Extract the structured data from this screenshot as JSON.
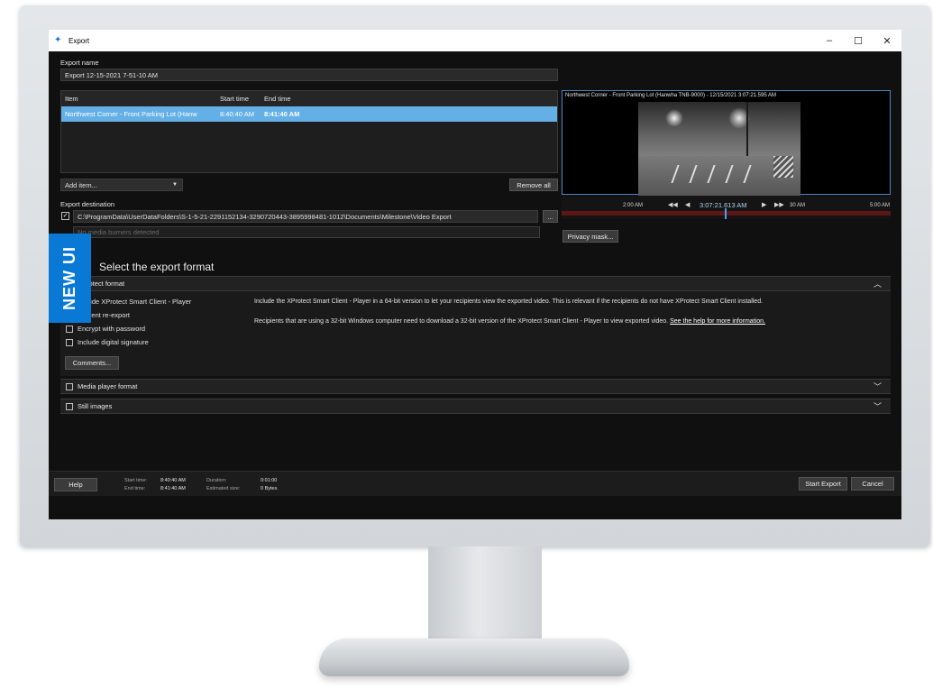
{
  "window": {
    "title": "Export",
    "controls": [
      "–",
      "☐",
      "✕"
    ]
  },
  "export_name": {
    "label": "Export name",
    "value": "Export 12-15-2021 7-51-10 AM"
  },
  "items_table": {
    "columns": [
      "Item",
      "Start time",
      "End time"
    ],
    "rows": [
      {
        "item": "Northwest Corner - Front Parking Lot  (Hanw",
        "start": "8:40:40 AM",
        "end": "8:41:40 AM"
      }
    ]
  },
  "add_item": {
    "label": "Add item..."
  },
  "remove_all": {
    "label": "Remove all"
  },
  "export_destination": {
    "label": "Export destination",
    "path": "C:\\ProgramData\\UserDataFolders\\S-1-5-21-2291152134-3290720443-3895998481-1012\\Documents\\Milestone\\Video Export",
    "browse_label": "...",
    "media_burners": "No media burners detected"
  },
  "preview": {
    "title": "Northwest Corner - Front Parking Lot  (Hanwha TNB-9000) - 12/15/2021 3:07:21.595 AM",
    "timeline_time": "3:07:21.613 AM",
    "tick_left": "2:00 AM",
    "tick_mid": "30 AM",
    "tick_right": "5:00 AM"
  },
  "privacy_mask": {
    "label": "Privacy mask..."
  },
  "section_title": "Select the export format",
  "xprotect": {
    "header": "XProtect format",
    "options": [
      "Include XProtect Smart Client - Player",
      "Prevent re-export",
      "Encrypt with password",
      "Include digital signature"
    ],
    "comments_label": "Comments...",
    "description1": "Include the XProtect Smart Client - Player in a 64-bit version to let your recipients view the exported video. This is relevant if the recipients do not have XProtect Smart Client installed.",
    "description2": "Recipients that are using a 32-bit Windows computer need to download a 32-bit version of the XProtect Smart Client - Player to view exported video.",
    "help_link": "See the help for more information."
  },
  "media_player": {
    "header": "Media player format"
  },
  "still_images": {
    "header": "Still images"
  },
  "footer": {
    "help_label": "Help",
    "start_time_label": "Start time:",
    "start_time_value": "8:40:40 AM",
    "end_time_label": "End time:",
    "end_time_value": "8:41:40 AM",
    "duration_label": "Duration:",
    "duration_value": "0:01:00",
    "size_label": "Estimated size:",
    "size_value": "0 Bytes",
    "start_export_label": "Start Export",
    "cancel_label": "Cancel"
  },
  "banner": {
    "text": "NEW UI"
  },
  "colors": {
    "accent": "#0a79d6",
    "selection": "#64b0e6",
    "background": "#101010"
  }
}
